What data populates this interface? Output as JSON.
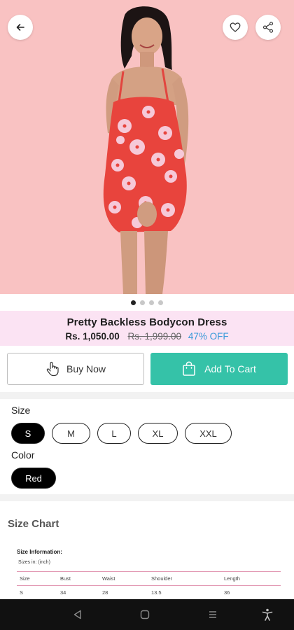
{
  "product": {
    "title": "Pretty Backless Bodycon Dress",
    "price": "Rs. 1,050.00",
    "mrp": "Rs. 1,999.00",
    "discount": "47% OFF",
    "image_count": 4,
    "active_image": 1
  },
  "header": {
    "back_icon": "arrow-left-icon",
    "wishlist_icon": "heart-icon",
    "share_icon": "share-icon"
  },
  "actions": {
    "buy_now_label": "Buy Now",
    "buy_now_icon": "hand-pointer-icon",
    "add_to_cart_label": "Add To Cart",
    "add_to_cart_icon": "shopping-bag-icon"
  },
  "options": {
    "size_label": "Size",
    "sizes": [
      "S",
      "M",
      "L",
      "XL",
      "XXL"
    ],
    "selected_size": "S",
    "color_label": "Color",
    "colors": [
      "Red"
    ],
    "selected_color": "Red"
  },
  "size_chart": {
    "title": "Size Chart",
    "info_label": "Size Information:",
    "units_label": "Sizes in: (inch)",
    "headers": [
      "Size",
      "Bust",
      "Waist",
      "Shoulder",
      "Length"
    ],
    "rows": [
      [
        "S",
        "34",
        "28",
        "13.5",
        "36"
      ]
    ]
  },
  "colors": {
    "hero_bg": "#f9c2c2",
    "title_band_bg": "#fbe3f3",
    "cart_button": "#35c2a8",
    "discount_text": "#3a9ad9",
    "table_rule": "#e39ab4"
  },
  "system_nav": {
    "back_icon": "nav-back-icon",
    "home_icon": "nav-home-icon",
    "recents_icon": "nav-recents-icon",
    "accessibility_icon": "accessibility-icon"
  }
}
